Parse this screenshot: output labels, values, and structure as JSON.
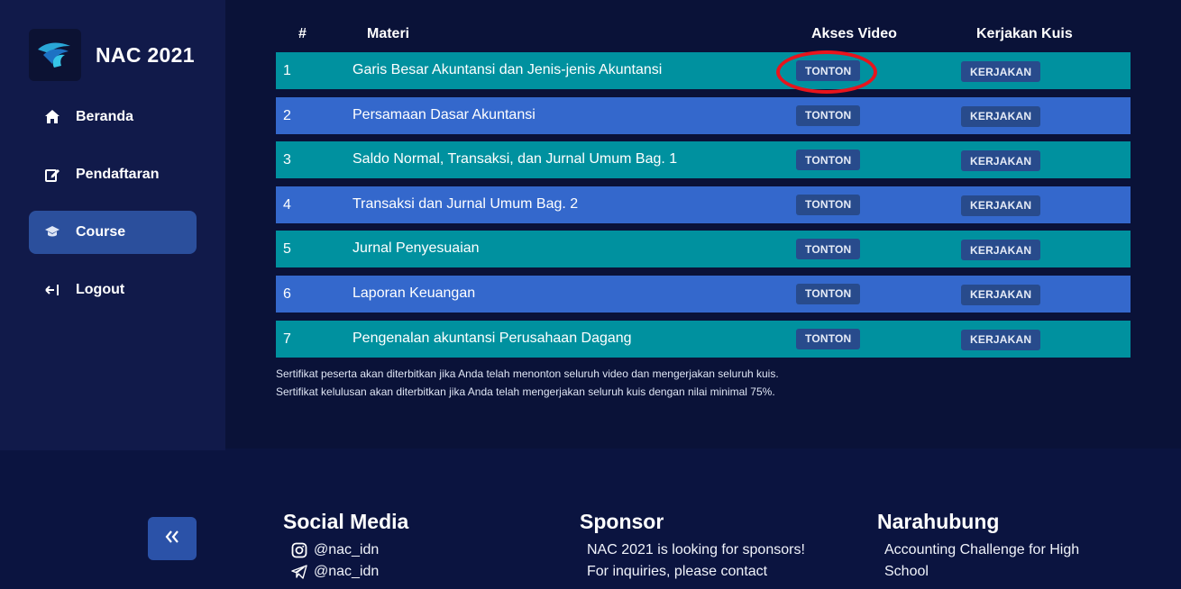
{
  "brand": {
    "title": "NAC 2021"
  },
  "sidebar": {
    "items": [
      {
        "label": "Beranda",
        "icon": "home-icon"
      },
      {
        "label": "Pendaftaran",
        "icon": "edit-icon"
      },
      {
        "label": "Course",
        "icon": "graduation-cap-icon",
        "active": true
      },
      {
        "label": "Logout",
        "icon": "logout-icon"
      }
    ]
  },
  "table": {
    "headers": {
      "num": "#",
      "materi": "Materi",
      "video": "Akses Video",
      "quiz": "Kerjakan Kuis"
    },
    "rows": [
      {
        "num": "1",
        "title": "Garis Besar Akuntansi dan Jenis-jenis Akuntansi",
        "watch": "TONTON",
        "quiz": "KERJAKAN"
      },
      {
        "num": "2",
        "title": "Persamaan Dasar Akuntansi",
        "watch": "TONTON",
        "quiz": "KERJAKAN"
      },
      {
        "num": "3",
        "title": "Saldo Normal, Transaksi, dan Jurnal Umum Bag. 1",
        "watch": "TONTON",
        "quiz": "KERJAKAN"
      },
      {
        "num": "4",
        "title": "Transaksi dan Jurnal Umum Bag. 2",
        "watch": "TONTON",
        "quiz": "KERJAKAN"
      },
      {
        "num": "5",
        "title": "Jurnal Penyesuaian",
        "watch": "TONTON",
        "quiz": "KERJAKAN"
      },
      {
        "num": "6",
        "title": "Laporan Keuangan",
        "watch": "TONTON",
        "quiz": "KERJAKAN"
      },
      {
        "num": "7",
        "title": "Pengenalan akuntansi Perusahaan Dagang",
        "watch": "TONTON",
        "quiz": "KERJAKAN"
      }
    ]
  },
  "notes": {
    "line1": "Sertifikat peserta akan diterbitkan jika Anda telah menonton seluruh video dan mengerjakan seluruh kuis.",
    "line2": "Sertifikat kelulusan akan diterbitkan jika Anda telah mengerjakan seluruh kuis dengan nilai minimal 75%."
  },
  "footer": {
    "social": {
      "title": "Social Media",
      "instagram": "@nac_idn",
      "telegram": "@nac_idn"
    },
    "sponsor": {
      "title": "Sponsor",
      "line1": "NAC 2021 is looking for sponsors!",
      "line2": "For inquiries, please contact"
    },
    "contact": {
      "title": "Narahubung",
      "line1": "Accounting Challenge for High",
      "line2": "School"
    }
  },
  "colors": {
    "row_teal": "#00919f",
    "row_blue": "#3468cc",
    "button": "#284b8c",
    "highlight": "#e8141c",
    "sidebar_active": "#2b4f9c"
  }
}
